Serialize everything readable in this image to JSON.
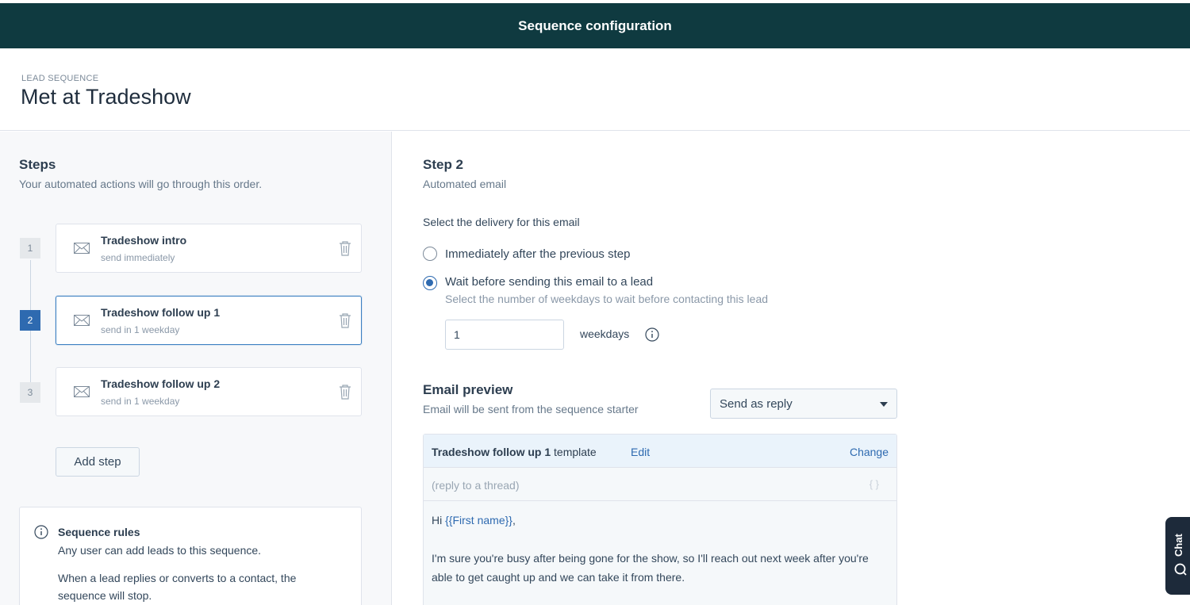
{
  "topbar": {
    "title": "Sequence configuration"
  },
  "header": {
    "kicker": "LEAD SEQUENCE",
    "title": "Met at Tradeshow"
  },
  "steps_panel": {
    "title": "Steps",
    "subtitle": "Your automated actions will go through this order.",
    "steps": [
      {
        "number": "1",
        "name": "Tradeshow intro",
        "when": "send immediately",
        "icon": "mail-icon",
        "active": false
      },
      {
        "number": "2",
        "name": "Tradeshow follow up 1",
        "when": "send in 1 weekday",
        "icon": "mail-icon",
        "active": true
      },
      {
        "number": "3",
        "name": "Tradeshow follow up 2",
        "when": "send in 1 weekday",
        "icon": "mail-icon",
        "active": false
      }
    ],
    "add_step_label": "Add step",
    "rules": {
      "title": "Sequence rules",
      "line1": "Any user can add leads to this sequence.",
      "line2": "When a lead replies or converts to a contact, the sequence will stop."
    }
  },
  "detail": {
    "step_title": "Step 2",
    "step_subtitle": "Automated email",
    "delivery_label": "Select the delivery for this email",
    "options": [
      {
        "label": "Immediately after the previous step",
        "checked": false
      },
      {
        "label": "Wait before sending this email to a lead",
        "checked": true
      }
    ],
    "wait_help": "Select the number of weekdays to wait before contacting this lead",
    "wait_value": "1",
    "wait_unit": "weekdays",
    "preview": {
      "title": "Email preview",
      "subtitle": "Email will be sent from the sequence starter",
      "send_mode": "Send as reply",
      "template_name": "Tradeshow follow up 1",
      "template_suffix": " template",
      "edit_label": "Edit",
      "change_label": "Change",
      "subject": "(reply to a thread)",
      "braces": "{ }",
      "greeting": "Hi ",
      "token": "{{First name}}",
      "greeting_end": ",",
      "body": "I'm sure you're busy after being gone for the show, so I'll reach out next week after you're able to get caught up and we can take it from there."
    }
  },
  "chat": {
    "label": "Chat"
  },
  "colors": {
    "topbar": "#0f3a40",
    "accent": "#2e6ab0",
    "panel": "#f7f8fa"
  }
}
